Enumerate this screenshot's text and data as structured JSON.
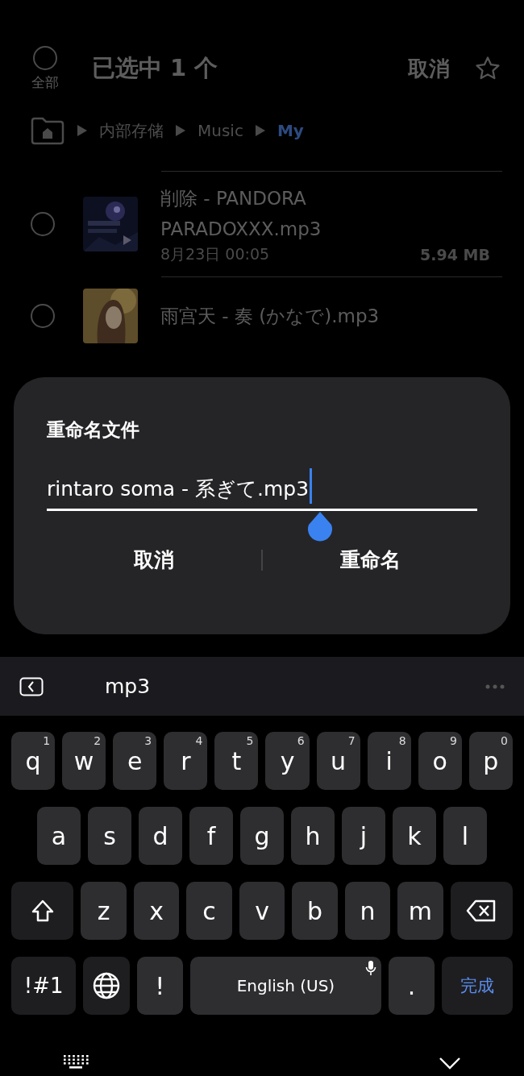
{
  "header": {
    "select_all": {
      "label": "全部",
      "checked": false
    },
    "title": "已选中 1 个",
    "cancel": "取消"
  },
  "breadcrumb": [
    {
      "label": "内部存储",
      "selected": false
    },
    {
      "label": "Music",
      "selected": false
    },
    {
      "label": "My",
      "selected": true
    }
  ],
  "files": [
    {
      "name": "削除 - PANDORA PARADOXXX.mp3",
      "date": "8月23日 00:05",
      "size": "5.94 MB",
      "checked": false
    },
    {
      "name": "雨宫天 - 奏 (かなで).mp3",
      "checked": false
    }
  ],
  "dialog": {
    "title": "重命名文件",
    "value": "rintaro soma - 系ぎて.mp3",
    "buttons": [
      {
        "label": "取消"
      },
      {
        "label": "重命名"
      }
    ]
  },
  "keyboard": {
    "suggestion": "mp3",
    "row_1": [
      {
        "label": "q",
        "hint": "1"
      },
      {
        "label": "w",
        "hint": "2"
      },
      {
        "label": "e",
        "hint": "3"
      },
      {
        "label": "r",
        "hint": "4"
      },
      {
        "label": "t",
        "hint": "5"
      },
      {
        "label": "y",
        "hint": "6"
      },
      {
        "label": "u",
        "hint": "7"
      },
      {
        "label": "i",
        "hint": "8"
      },
      {
        "label": "o",
        "hint": "9"
      },
      {
        "label": "p",
        "hint": "0"
      }
    ],
    "row_2": [
      {
        "label": "a"
      },
      {
        "label": "s"
      },
      {
        "label": "d"
      },
      {
        "label": "f"
      },
      {
        "label": "g"
      },
      {
        "label": "h"
      },
      {
        "label": "j"
      },
      {
        "label": "k"
      },
      {
        "label": "l"
      }
    ],
    "row_3": [
      {
        "kind": "shift"
      },
      {
        "label": "z"
      },
      {
        "label": "x"
      },
      {
        "label": "c"
      },
      {
        "label": "v"
      },
      {
        "label": "b"
      },
      {
        "label": "n"
      },
      {
        "label": "m"
      },
      {
        "kind": "backspace"
      }
    ],
    "bottom_row": [
      {
        "kind": "symbols",
        "label": "!#1"
      },
      {
        "kind": "globe"
      },
      {
        "label": "!"
      },
      {
        "kind": "space",
        "label": "English (US)"
      },
      {
        "label": "."
      },
      {
        "kind": "done",
        "label": "完成"
      }
    ]
  }
}
